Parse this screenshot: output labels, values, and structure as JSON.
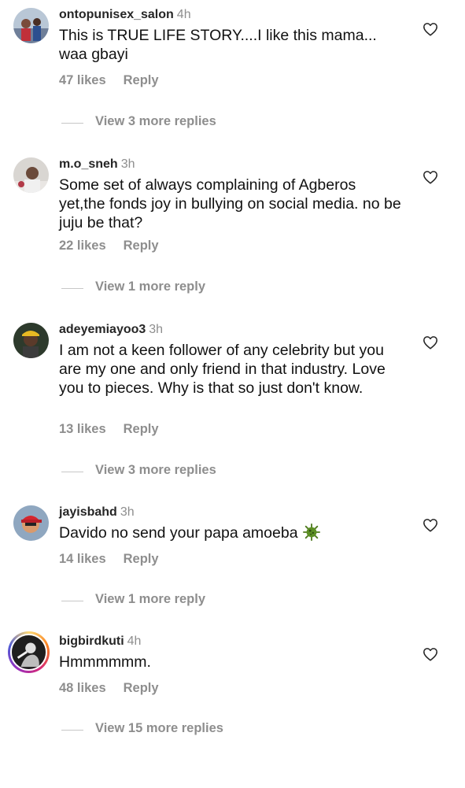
{
  "comments": [
    {
      "username": "ontopunisex_salon",
      "time": "4h",
      "text": "This is TRUE LIFE STORY....I like this mama... waa gbayi",
      "likes": "47 likes",
      "reply_label": "Reply",
      "view_replies": "View 3 more replies",
      "avatar": "avatar-photo-people"
    },
    {
      "username": "m.o_sneh",
      "time": "3h",
      "text": "Some set of always complaining of Agberos yet,the fonds joy in bullying on social media. no be juju be that?",
      "likes": "22 likes",
      "reply_label": "Reply",
      "view_replies": "View 1 more reply",
      "avatar": "avatar-photo-person"
    },
    {
      "username": "adeyemiayoo3",
      "time": "3h",
      "text": "I am not a keen follower of any celebrity but you are my one and only friend in that industry. Love you to pieces.  Why is that so just don't know.",
      "likes": "13 likes",
      "reply_label": "Reply",
      "view_replies": "View 3 more replies",
      "avatar": "avatar-photo-person-hat"
    },
    {
      "username": "jayisbahd",
      "time": "3h",
      "text": "Davido no send your papa amoeba",
      "emoji": "microbe-emoji",
      "likes": "14 likes",
      "reply_label": "Reply",
      "view_replies": "View 1 more reply",
      "avatar": "avatar-cartoon-red-cap"
    },
    {
      "username": "bigbirdkuti",
      "time": "4h",
      "text": "Hmmmmmm.",
      "likes": "48 likes",
      "reply_label": "Reply",
      "view_replies": "View 15 more replies",
      "avatar": "avatar-photo-story-ring"
    }
  ],
  "icons": {
    "like": "heart-outline-icon"
  },
  "colors": {
    "secondary_text": "#8e8e8e",
    "primary_text": "#262626",
    "divider": "#c7c7c7"
  }
}
